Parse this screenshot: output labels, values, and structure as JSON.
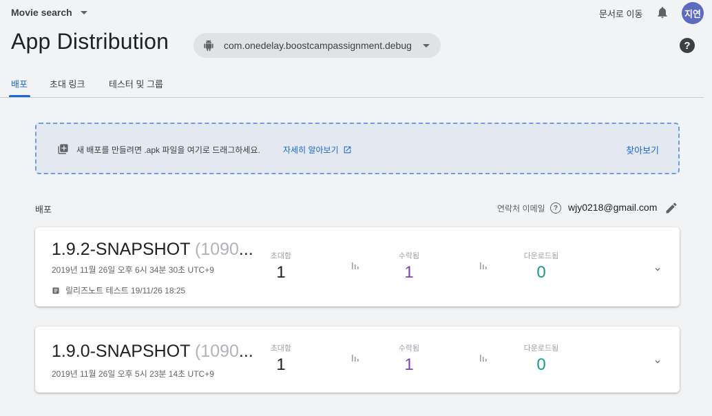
{
  "header": {
    "project_name": "Movie search",
    "docs_link": "문서로 이동",
    "avatar_text": "지연",
    "page_title": "App Distribution",
    "package_name": "com.onedelay.boostcampassignment.debug",
    "help_glyph": "?"
  },
  "tabs": [
    {
      "label": "배포",
      "active": true
    },
    {
      "label": "초대 링크",
      "active": false
    },
    {
      "label": "테스터 및 그룹",
      "active": false
    }
  ],
  "dropzone": {
    "text": "새 배포를 만들려면 .apk 파일을 여기로 드래그하세요.",
    "learn_more": "자세히 알아보기",
    "browse": "찾아보기"
  },
  "releases_section": {
    "label": "배포",
    "contact_label": "연락처 이메일",
    "contact_help_glyph": "?",
    "contact_email": "wjy0218@gmail.com"
  },
  "releases": [
    {
      "version": "1.9.2-SNAPSHOT",
      "build": "(1090",
      "ellipsis": "...",
      "date": "2019년 11월 26일 오후 6시 34분 30초 UTC+9",
      "notes": "릴리즈노트 테스트 19/11/26 18:25",
      "invites_label": "초대함",
      "invites": "1",
      "accepted_label": "수락됨",
      "accepted": "1",
      "downloads_label": "다운로드됨",
      "downloads": "0"
    },
    {
      "version": "1.9.0-SNAPSHOT",
      "build": "(1090",
      "ellipsis": "...",
      "date": "2019년 11월 26일 오후 5시 23분 14초 UTC+9",
      "invites_label": "초대함",
      "invites": "1",
      "accepted_label": "수락됨",
      "accepted": "1",
      "downloads_label": "다운로드됨",
      "downloads": "0"
    }
  ],
  "colors": {
    "accent_blue": "#1967d2",
    "accepted_purple": "#7b3fbf",
    "downloads_teal": "#129e8c",
    "avatar_bg": "#5c6bc0"
  },
  "icons": [
    "chevron-down-icon",
    "bell-icon",
    "help-icon",
    "android-icon",
    "add-box-icon",
    "external-link-icon",
    "edit-icon",
    "notes-icon",
    "bar-chart-icon",
    "expand-icon"
  ]
}
